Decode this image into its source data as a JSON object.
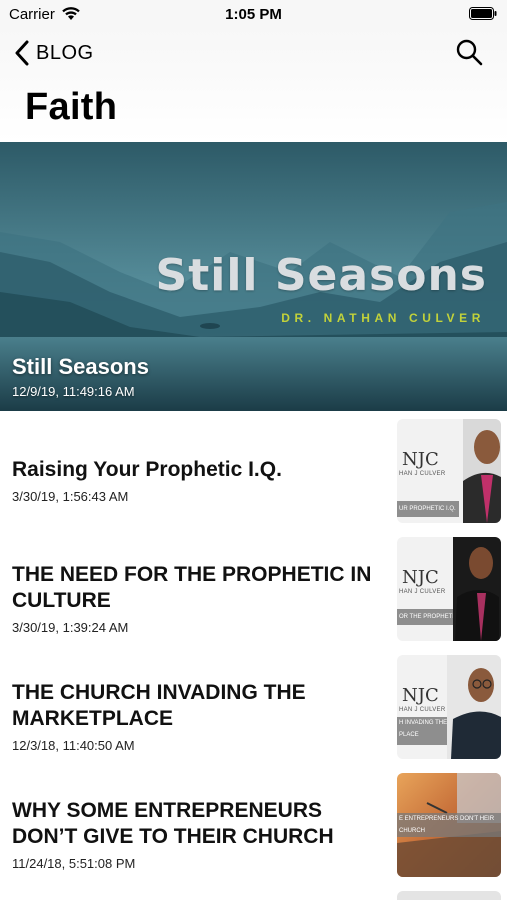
{
  "status_bar": {
    "carrier": "Carrier",
    "time": "1:05 PM",
    "wifi_icon": "wifi-icon",
    "battery_icon": "battery-icon"
  },
  "nav": {
    "back_label": "BLOG",
    "back_icon": "chevron-left-icon",
    "search_icon": "search-icon",
    "title": "Faith"
  },
  "featured": {
    "graphic_title": "Still Seasons",
    "graphic_author": "DR. NATHAN CULVER",
    "title": "Still Seasons",
    "date": "12/9/19, 11:49:16 AM"
  },
  "posts": [
    {
      "title": "Raising Your Prophetic I.Q.",
      "date": "3/30/19, 1:56:43 AM",
      "thumb_text": "UR PROPHETIC I.Q."
    },
    {
      "title": "THE NEED FOR THE PROPHETIC IN CULTURE",
      "date": "3/30/19, 1:39:24 AM",
      "thumb_text": "OR THE PROPHETIC"
    },
    {
      "title": "THE CHURCH INVADING THE MARKETPLACE",
      "date": "12/3/18, 11:40:50 AM",
      "thumb_text": "H INVADING THE PLACE"
    },
    {
      "title": "WHY SOME ENTREPRENEURS DON’T GIVE TO THEIR CHURCH",
      "date": "11/24/18, 5:51:08 PM",
      "thumb_text": "E ENTREPRENEURS DON'T HEIR CHURCH"
    }
  ],
  "thumb_brand": {
    "monogram": "NJC",
    "subline": "HAN J CULVER"
  },
  "colors": {
    "hero_author_accent": "#c2d23a",
    "nav_background": "#f7f7f7"
  }
}
